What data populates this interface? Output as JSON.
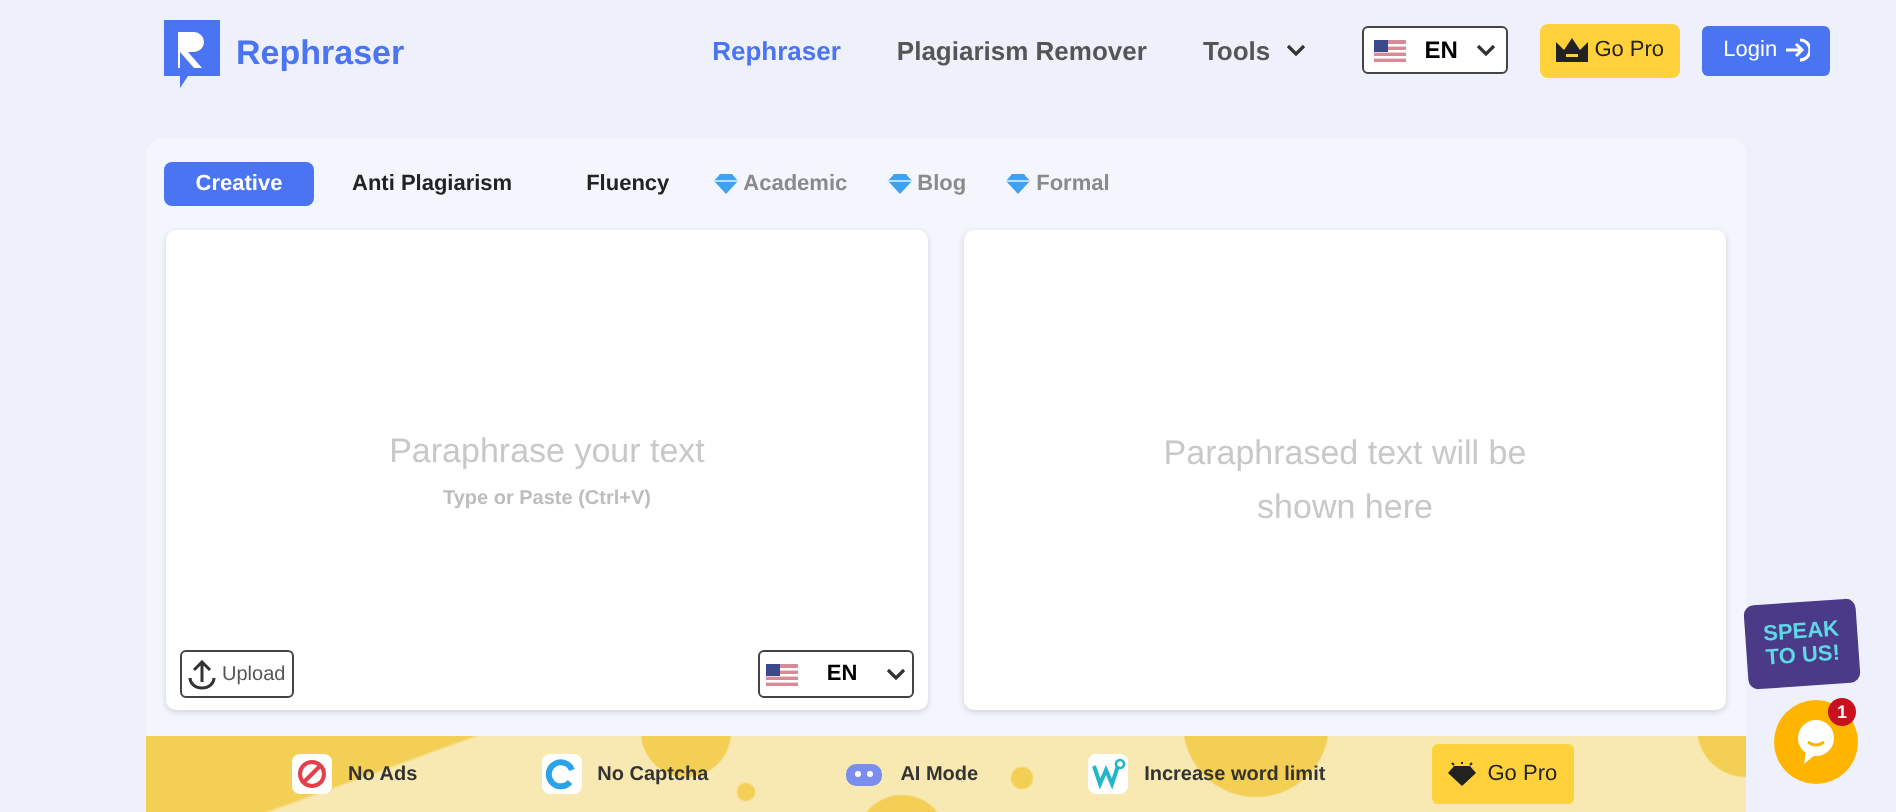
{
  "header": {
    "brand": "Rephraser",
    "nav": [
      {
        "label": "Rephraser",
        "selected": true,
        "kind": "link"
      },
      {
        "label": "Plagiarism Remover",
        "selected": false,
        "kind": "link"
      },
      {
        "label": "Tools",
        "selected": false,
        "kind": "dropdown"
      }
    ],
    "language": "EN",
    "go_pro": "Go Pro",
    "login": "Login"
  },
  "tabs": [
    {
      "label": "Creative",
      "selected": true,
      "premium": false
    },
    {
      "label": "Anti Plagiarism",
      "selected": false,
      "premium": false
    },
    {
      "label": "Fluency",
      "selected": false,
      "premium": false
    },
    {
      "label": "Academic",
      "selected": false,
      "premium": true
    },
    {
      "label": "Blog",
      "selected": false,
      "premium": true
    },
    {
      "label": "Formal",
      "selected": false,
      "premium": true
    }
  ],
  "input": {
    "prompt": "Paraphrase your text",
    "hint": "Type or Paste (Ctrl+V)",
    "upload": "Upload",
    "language": "EN"
  },
  "output": {
    "prompt": "Paraphrased text will be shown here"
  },
  "banner": {
    "features": [
      {
        "label": "No Ads",
        "kind": "no-ads"
      },
      {
        "label": "No Captcha",
        "kind": "captcha"
      },
      {
        "label": "AI Mode",
        "kind": "robot"
      },
      {
        "label": "Increase word limit",
        "kind": "word"
      }
    ],
    "go_pro": "Go Pro"
  },
  "chat": {
    "sticker": [
      "SPEAK",
      "TO US!"
    ],
    "unread": "1"
  }
}
